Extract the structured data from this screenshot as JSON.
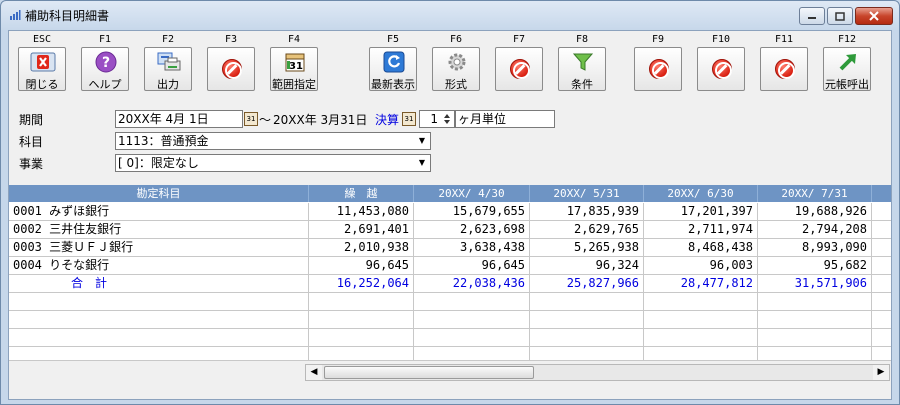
{
  "window": {
    "title": "補助科目明細書",
    "controls": {
      "minimize": "—",
      "maximize": "□",
      "close": "✕"
    }
  },
  "toolbar": [
    {
      "key": "ESC",
      "label": "閉じる",
      "icon": "close-x-icon"
    },
    {
      "key": "F1",
      "label": "ヘルプ",
      "icon": "help-icon"
    },
    {
      "key": "F2",
      "label": "出力",
      "icon": "output-icon"
    },
    {
      "key": "F3",
      "label": "",
      "icon": "disabled-icon"
    },
    {
      "key": "F4",
      "label": "範囲指定",
      "icon": "calendar-icon",
      "icon_text": "31"
    },
    {
      "key": "F5",
      "label": "最新表示",
      "icon": "refresh-icon"
    },
    {
      "key": "F6",
      "label": "形式",
      "icon": "gear-icon"
    },
    {
      "key": "F7",
      "label": "",
      "icon": "disabled-icon"
    },
    {
      "key": "F8",
      "label": "条件",
      "icon": "filter-icon"
    },
    {
      "key": "F9",
      "label": "",
      "icon": "disabled-icon"
    },
    {
      "key": "F10",
      "label": "",
      "icon": "disabled-icon"
    },
    {
      "key": "F11",
      "label": "",
      "icon": "disabled-icon"
    },
    {
      "key": "F12",
      "label": "元帳呼出",
      "icon": "arrow-up-right-icon"
    }
  ],
  "form": {
    "period_label": "期間",
    "period_start": "20XX年 4月 1日",
    "period_sep": "～",
    "period_end": "20XX年 3月31日",
    "closing_label": "決算",
    "unit_value": "1",
    "unit_label": "ヶ月単位",
    "account_label": "科目",
    "account_value": "1113：普通預金",
    "project_label": "事業",
    "project_value": "[    0]：限定なし"
  },
  "grid": {
    "columns": [
      "勘定科目",
      "繰　越",
      "20XX/ 4/30",
      "20XX/ 5/31",
      "20XX/ 6/30",
      "20XX/ 7/31"
    ],
    "rows": [
      [
        "0001 みずほ銀行",
        "11,453,080",
        "15,679,655",
        "17,835,939",
        "17,201,397",
        "19,688,926"
      ],
      [
        "0002 三井住友銀行",
        "2,691,401",
        "2,623,698",
        "2,629,765",
        "2,711,974",
        "2,794,208"
      ],
      [
        "0003 三菱ＵＦＪ銀行",
        "2,010,938",
        "3,638,438",
        "5,265,938",
        "8,468,438",
        "8,993,090"
      ],
      [
        "0004 りそな銀行",
        "96,645",
        "96,645",
        "96,324",
        "96,003",
        "95,682"
      ]
    ],
    "total": [
      "合　計",
      "16,252,064",
      "22,038,436",
      "25,827,966",
      "28,477,812",
      "31,571,906"
    ]
  },
  "colors": {
    "header_bg": "#6e94c4",
    "total_text": "#0000e0"
  }
}
